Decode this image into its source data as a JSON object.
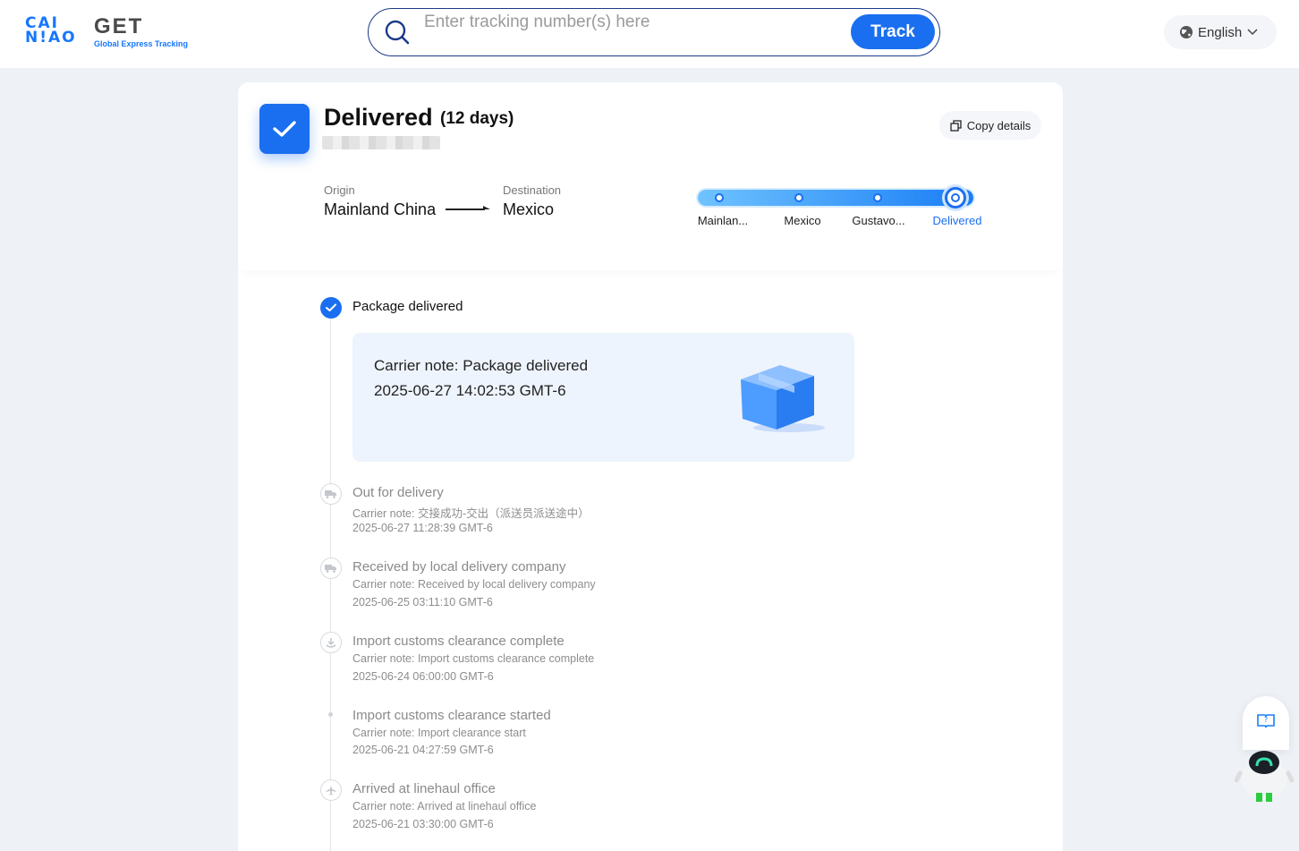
{
  "header": {
    "logo_mark_line1": "CAI",
    "logo_mark_line2": "N!AO",
    "logo_title": "GET",
    "logo_subtitle": "Global Express Tracking",
    "search_placeholder": "Enter tracking number(s) here",
    "track_label": "Track",
    "language": "English"
  },
  "summary": {
    "status": "Delivered",
    "duration": "(12 days)",
    "copy_label": "Copy details",
    "origin_label": "Origin",
    "origin_value": "Mainland China",
    "destination_label": "Destination",
    "destination_value": "Mexico",
    "progress_steps": [
      "Mainlan...",
      "Mexico",
      "Gustavo...",
      "Delivered"
    ],
    "progress_active_index": 3
  },
  "timeline": {
    "latest": {
      "title": "Package delivered",
      "note": "Carrier note: Package delivered",
      "time": "2025-06-27 14:02:53 GMT-6"
    },
    "events": [
      {
        "title": "Out for delivery",
        "note": "Carrier note: 交接成功-交出（派送员派送途中）",
        "time": "2025-06-27 11:28:39 GMT-6",
        "icon": "truck-icon"
      },
      {
        "title": "Received by local delivery company",
        "note": "Carrier note: Received by local delivery company",
        "time": "2025-06-25 03:11:10 GMT-6",
        "icon": "truck-icon"
      },
      {
        "title": "Import customs clearance complete",
        "note": "Carrier note: Import customs clearance complete",
        "time": "2025-06-24 06:00:00 GMT-6",
        "icon": "customs-icon"
      },
      {
        "title": "Import customs clearance started",
        "note": "Carrier note: Import clearance start",
        "time": "2025-06-21 04:27:59 GMT-6",
        "icon": "dot"
      },
      {
        "title": "Arrived at linehaul office",
        "note": "Carrier note: Arrived at linehaul office",
        "time": "2025-06-21 03:30:00 GMT-6",
        "icon": "plane-icon"
      }
    ]
  },
  "colors": {
    "accent": "#1a6ff0",
    "page_bg": "#eef1f6",
    "detail_bg": "#eef4fd"
  }
}
